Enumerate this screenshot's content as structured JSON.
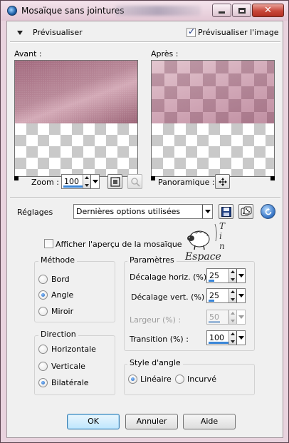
{
  "window": {
    "title": "Mosaïque sans jointures",
    "controls": [
      "minimize-icon",
      "maximize-icon",
      "close-icon"
    ]
  },
  "preview": {
    "toggle_label": "Prévisualiser",
    "show_image_label": "Prévisualiser l'image",
    "show_image_checked": true,
    "before_label": "Avant :",
    "after_label": "Après :",
    "zoom_label": "Zoom :",
    "zoom_value": "100",
    "pan_label": "Panoramique :"
  },
  "presets": {
    "label": "Réglages",
    "value": "Dernières options utilisées",
    "icons": [
      "save-icon",
      "randomize-dice-icon",
      "reset-icon"
    ]
  },
  "tile_preview": {
    "label": "Afficher l'aperçu de la mosaïque",
    "checked": false
  },
  "watermark": {
    "text": "Espace",
    "letters": "Tin"
  },
  "method": {
    "title": "Méthode",
    "options": [
      "Bord",
      "Angle",
      "Miroir"
    ],
    "selected": "Angle"
  },
  "direction": {
    "title": "Direction",
    "options": [
      "Horizontale",
      "Verticale",
      "Bilatérale"
    ],
    "selected": "Bilatérale"
  },
  "parameters": {
    "title": "Paramètres",
    "fields": [
      {
        "label": "Décalage horiz. (%) :",
        "value": "25",
        "enabled": true
      },
      {
        "label": "Décalage vert. (%) :",
        "value": "25",
        "enabled": true
      },
      {
        "label": "Largeur (%) :",
        "value": "50",
        "enabled": false
      },
      {
        "label": "Transition (%) :",
        "value": "100",
        "enabled": true
      }
    ]
  },
  "corner_style": {
    "title": "Style d'angle",
    "options": [
      "Linéaire",
      "Incurvé"
    ],
    "selected": "Linéaire"
  },
  "buttons": {
    "ok": "OK",
    "cancel": "Annuler",
    "help": "Aide"
  },
  "colors": {
    "window_frame": "#e9d3de",
    "close_button": "#c8473a",
    "accent": "#3a86d8"
  }
}
